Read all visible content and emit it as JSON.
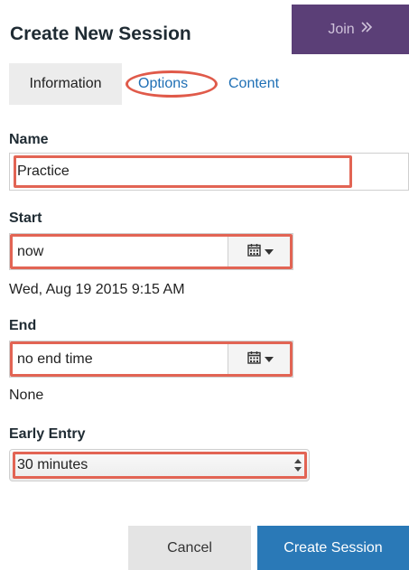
{
  "header": {
    "title": "Create New Session",
    "join_label": "Join",
    "join_icon": "double-chevron-right-icon"
  },
  "tabs": [
    {
      "label": "Information",
      "active": true
    },
    {
      "label": "Options",
      "active": false
    },
    {
      "label": "Content",
      "active": false
    }
  ],
  "form": {
    "name": {
      "label": "Name",
      "value": "Practice"
    },
    "start": {
      "label": "Start",
      "value": "now",
      "resolved": "Wed, Aug 19 2015 9:15 AM",
      "icon": "calendar-icon"
    },
    "end": {
      "label": "End",
      "value": "no end time",
      "resolved": "None",
      "icon": "calendar-icon"
    },
    "early_entry": {
      "label": "Early Entry",
      "value": "30 minutes"
    }
  },
  "actions": {
    "cancel_label": "Cancel",
    "create_label": "Create Session"
  },
  "colors": {
    "highlight": "#e26454",
    "join_bg": "#5b3f77",
    "primary": "#2a79b7",
    "link": "#1e6fb5"
  }
}
